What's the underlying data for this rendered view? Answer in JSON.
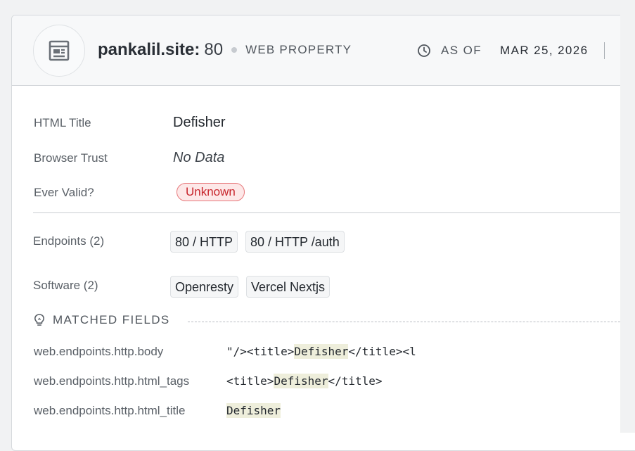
{
  "header": {
    "host": "pankalil.site:",
    "port": "80",
    "property_type": "WEB PROPERTY",
    "as_of_label": "AS OF",
    "as_of_date": "MAR 25, 2026",
    "icon": "web-page-icon"
  },
  "details": {
    "html_title": {
      "label": "HTML Title",
      "value": "Defisher"
    },
    "browser_trust": {
      "label": "Browser Trust",
      "value": "No Data"
    },
    "ever_valid": {
      "label": "Ever Valid?",
      "value": "Unknown"
    }
  },
  "endpoints": {
    "label": "Endpoints (2)",
    "items": [
      "80 / HTTP",
      "80 / HTTP /auth"
    ]
  },
  "software": {
    "label": "Software (2)",
    "items": [
      "Openresty",
      "Vercel Nextjs"
    ]
  },
  "matched": {
    "title": "MATCHED FIELDS",
    "icon": "lightbulb-icon",
    "rows": [
      {
        "field": "web.endpoints.http.body",
        "pre": "\"/><title>",
        "match": "Defisher",
        "post": "</title><l"
      },
      {
        "field": "web.endpoints.http.html_tags",
        "pre": "<title>",
        "match": "Defisher",
        "post": "</title>"
      },
      {
        "field": "web.endpoints.http.html_title",
        "pre": "",
        "match": "Defisher",
        "post": ""
      }
    ]
  },
  "colors": {
    "badge_text": "#c8252c",
    "badge_bg": "#fde8e8",
    "highlight": "#eeeedb"
  }
}
